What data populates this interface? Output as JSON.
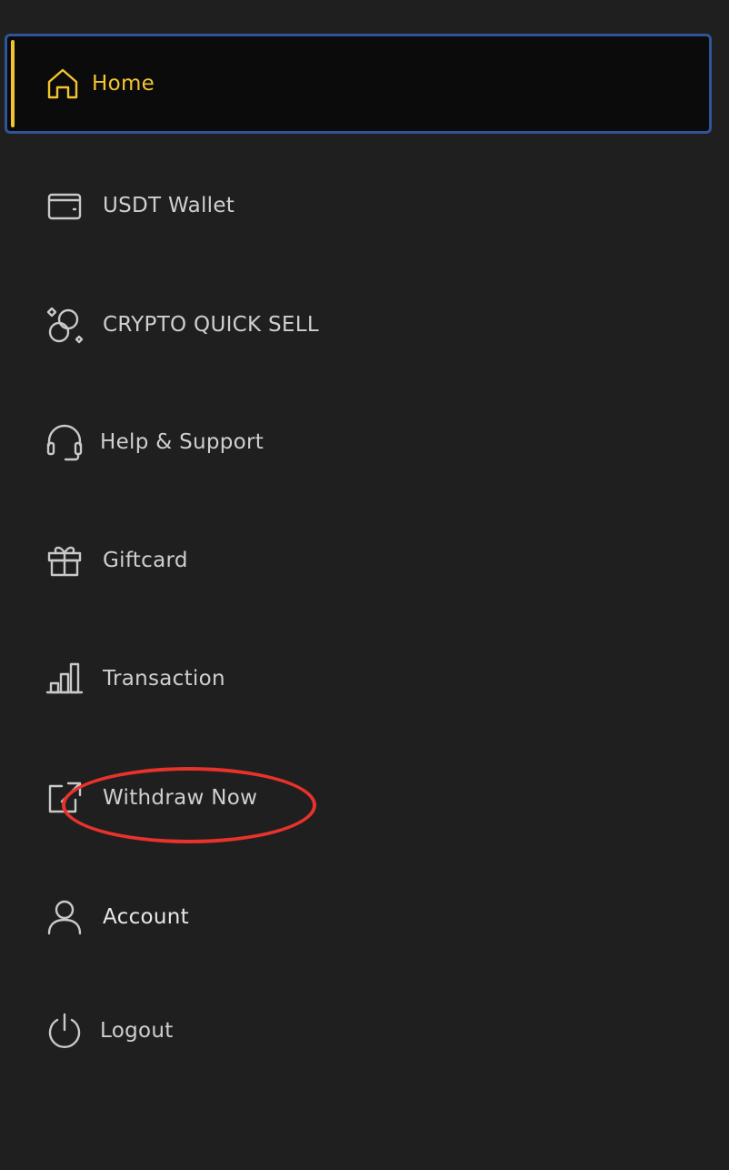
{
  "menu": {
    "items": [
      {
        "label": "Home",
        "icon": "home-icon",
        "active": true
      },
      {
        "label": "USDT Wallet",
        "icon": "wallet-icon"
      },
      {
        "label": "CRYPTO QUICK SELL",
        "icon": "coins-icon"
      },
      {
        "label": "Help & Support",
        "icon": "headset-icon"
      },
      {
        "label": "Giftcard",
        "icon": "gift-icon"
      },
      {
        "label": "Transaction",
        "icon": "bar-chart-icon"
      },
      {
        "label": "Withdraw Now",
        "icon": "external-link-icon"
      },
      {
        "label": "Account",
        "icon": "user-icon"
      },
      {
        "label": "Logout",
        "icon": "power-icon"
      }
    ]
  },
  "colors": {
    "background": "#1f1f1f",
    "active_accent": "#f4c430",
    "active_border": "#2f5597",
    "annotation": "#e8322b"
  }
}
